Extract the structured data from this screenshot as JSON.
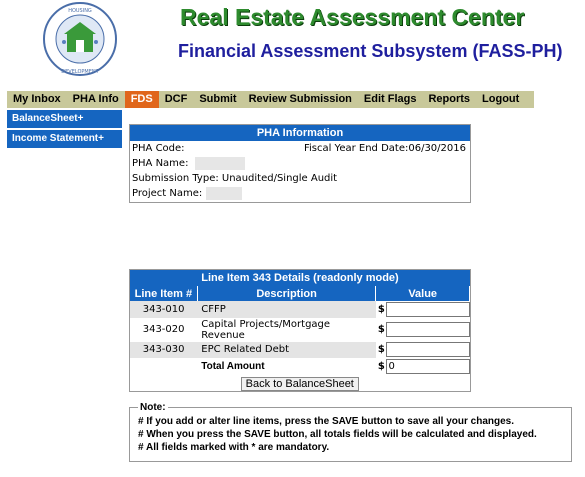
{
  "header": {
    "title": "Real Estate Assessment Center",
    "subtitle": "Financial Assessment Subsystem (FASS-PH)",
    "seal": {
      "icon": "hud-seal-icon",
      "text": "U.S. DEPARTMENT OF HOUSING AND URBAN DEVELOPMENT"
    }
  },
  "nav": {
    "items": [
      "My Inbox",
      "PHA Info",
      "FDS",
      "DCF",
      "Submit",
      "Review Submission",
      "Edit Flags",
      "Reports",
      "Logout"
    ],
    "active": "FDS"
  },
  "sidebar": {
    "items": [
      "BalanceSheet+",
      "Income Statement+"
    ]
  },
  "pha_info": {
    "title": "PHA Information",
    "pha_code_label": "PHA Code:",
    "fiscal_year_end_label": "Fiscal Year End Date:06/30/2016",
    "pha_name_label": "PHA Name:",
    "submission_type": "Submission Type: Unaudited/Single Audit",
    "project_name_label": "Project Name:"
  },
  "line_item": {
    "title": "Line Item 343 Details (readonly mode)",
    "columns": [
      "Line Item #",
      "Description",
      "Value"
    ],
    "rows": [
      {
        "code": "343-010",
        "description": "CFFP",
        "value": ""
      },
      {
        "code": "343-020",
        "description": "Capital Projects/Mortgage Revenue",
        "value": ""
      },
      {
        "code": "343-030",
        "description": "EPC Related Debt",
        "value": ""
      }
    ],
    "currency": "$",
    "total_label": "Total Amount",
    "total_value": "0",
    "back_button": "Back to BalanceSheet"
  },
  "note": {
    "legend": "Note:",
    "lines": [
      "# If you add or alter line items, press the SAVE button to save all your changes.",
      "# When you press the SAVE button, all totals fields will be calculated and displayed.",
      "# All fields marked with * are mandatory."
    ]
  },
  "colors": {
    "nav_bg": "#c8c89a",
    "nav_active": "#e0661b",
    "header_blue": "#1565c0",
    "title_green": "#2e8b2e",
    "subtitle_blue": "#1f1f9e"
  }
}
